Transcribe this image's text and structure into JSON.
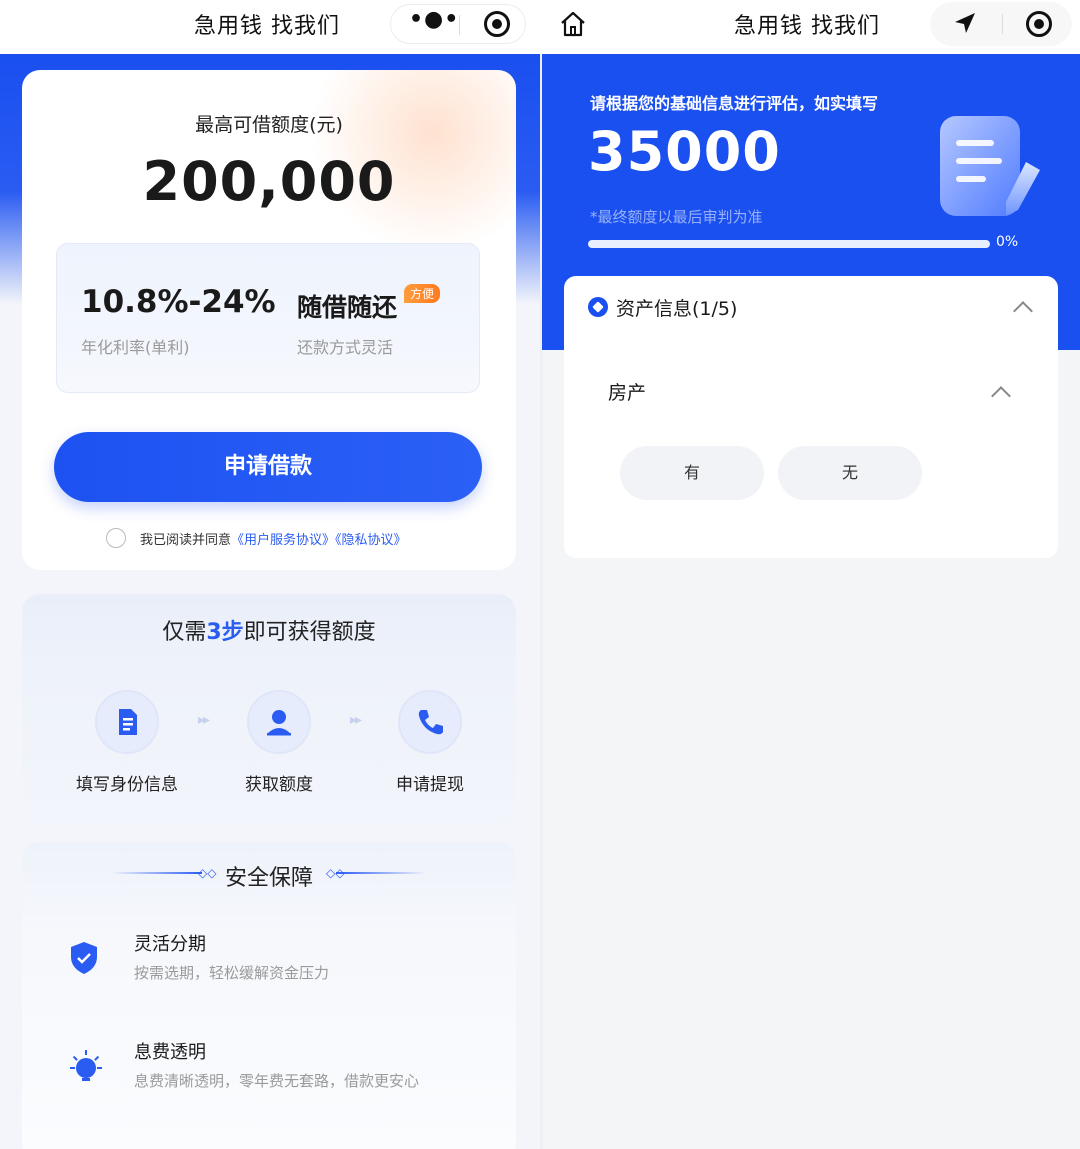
{
  "left": {
    "header": {
      "title": "急用钱 找我们",
      "more_icon": "more-dots-icon",
      "target_icon": "target-icon"
    },
    "loan": {
      "max_label": "最高可借额度(元)",
      "max_amount": "200,000",
      "rate_value": "10.8%-24%",
      "rate_label": "年化利率(单利)",
      "repay_value": "随借随还",
      "repay_badge": "方便",
      "repay_label": "还款方式灵活",
      "apply_button": "申请借款",
      "agree_prefix": "我已阅读并同意",
      "agree_link1": "《用户服务协议》",
      "agree_link2": "《隐私协议》"
    },
    "steps": {
      "title_pre": "仅需",
      "title_highlight": "3步",
      "title_post": "即可获得额度",
      "items": [
        {
          "label": "填写身份信息",
          "icon": "document-icon"
        },
        {
          "label": "获取额度",
          "icon": "user-icon"
        },
        {
          "label": "申请提现",
          "icon": "phone-icon"
        }
      ]
    },
    "security": {
      "title": "安全保障",
      "features": [
        {
          "title": "灵活分期",
          "desc": "按需选期，轻松缓解资金压力",
          "icon": "shield-check-icon"
        },
        {
          "title": "息费透明",
          "desc": "息费清晰透明，零年费无套路，借款更安心",
          "icon": "bulb-icon"
        }
      ]
    },
    "colors": {
      "accent": "#1a4ff0",
      "badge": "#ff8a2a"
    }
  },
  "right": {
    "header": {
      "title": "急用钱 找我们",
      "home_icon": "home-icon",
      "nav_icon": "location-arrow-icon",
      "target_icon": "target-icon"
    },
    "banner": {
      "hint": "请根据您的基础信息进行评估，如实填写",
      "amount": "35000",
      "note": "*最终额度以最后审判为准",
      "progress": 0,
      "progress_label": "0%"
    },
    "form": {
      "section_title": "资产信息(1/5)",
      "question": "房产",
      "options": [
        "有",
        "无"
      ]
    }
  }
}
